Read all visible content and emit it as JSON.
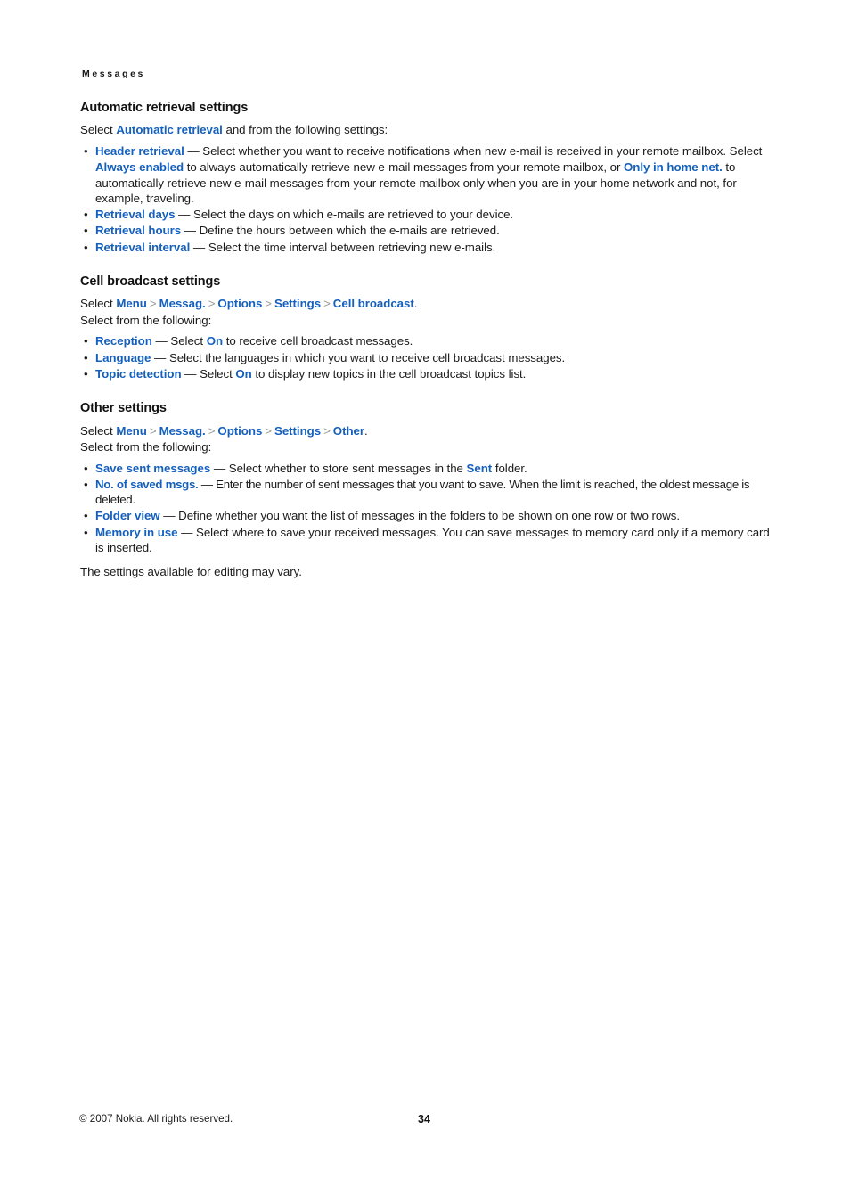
{
  "running_head": "Messages",
  "colors": {
    "link": "#1560bd",
    "body_text": "#1a1a1a",
    "chevron": "#9a9a9a",
    "page_background": "#ffffff"
  },
  "sections": [
    {
      "id": "automatic-retrieval-settings",
      "heading": "Automatic retrieval settings",
      "intro": {
        "before": "Select ",
        "link": "Automatic retrieval",
        "after": " and from the following settings:"
      },
      "bullets": [
        {
          "term": "Header retrieval",
          "dash": " — ",
          "text_1": "Select whether you want to receive notifications when new e-mail is received in your remote mailbox. Select ",
          "link_2": "Always enabled",
          "text_2": " to always automatically retrieve new e-mail messages from your remote mailbox, or ",
          "link_3": "Only in home net.",
          "text_3": " to automatically retrieve new e-mail messages from your remote mailbox only when you are in your home network and not, for example, traveling."
        },
        {
          "term": "Retrieval days",
          "dash": " — ",
          "text_1": "Select the days on which e-mails are retrieved to your device."
        },
        {
          "term": "Retrieval hours",
          "dash": " — ",
          "text_1": "Define the hours between which the e-mails are retrieved."
        },
        {
          "term": "Retrieval interval",
          "dash": " — ",
          "text_1": "Select the time interval between retrieving new e-mails."
        }
      ]
    },
    {
      "id": "cell-broadcast-settings",
      "heading": "Cell broadcast settings",
      "path": {
        "prefix": "Select ",
        "steps": [
          "Menu",
          "Messag.",
          "Options",
          "Settings",
          "Cell broadcast"
        ],
        "separator": ">",
        "suffix": "."
      },
      "lead_in": "Select from the following:",
      "bullets": [
        {
          "term": "Reception",
          "dash": " — ",
          "text_1": "Select ",
          "link_2": "On",
          "text_2": " to receive cell broadcast messages."
        },
        {
          "term": "Language",
          "dash": " — ",
          "text_1": "Select the languages in which you want to receive cell broadcast messages."
        },
        {
          "term": "Topic detection",
          "dash": " — ",
          "text_1": "Select ",
          "link_2": "On",
          "text_2": " to display new topics in the cell broadcast topics list."
        }
      ]
    },
    {
      "id": "other-settings",
      "heading": "Other settings",
      "path": {
        "prefix": "Select ",
        "steps": [
          "Menu",
          "Messag.",
          "Options",
          "Settings",
          "Other"
        ],
        "separator": ">",
        "suffix": "."
      },
      "lead_in": "Select from the following:",
      "bullets": [
        {
          "term": "Save sent messages",
          "dash": " — ",
          "text_1": "Select whether to store sent messages in the ",
          "link_2": "Sent",
          "text_2": " folder."
        },
        {
          "term": "No. of saved msgs.",
          "dash": " — ",
          "text_1": "Enter the number of sent messages that you want to save. When the limit is reached, the oldest message is deleted."
        },
        {
          "term": "Folder view",
          "dash": " — ",
          "text_1": "Define whether you want the list of messages in the folders to be shown on one row or two rows."
        },
        {
          "term": "Memory in use",
          "dash": " — ",
          "text_1": "Select where to save your received messages. You can save messages to memory card only if a memory card is inserted."
        }
      ],
      "closing_note": "The settings available for editing may vary."
    }
  ],
  "footer": {
    "copyright": "© 2007 Nokia. All rights reserved.",
    "page_number": "34"
  }
}
